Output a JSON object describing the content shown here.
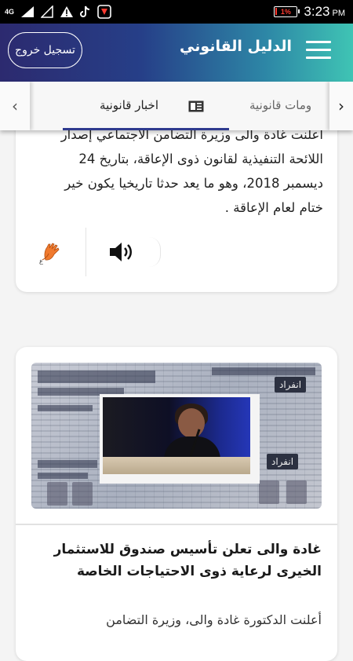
{
  "status_bar": {
    "network": "4G",
    "battery": "1%",
    "time": "3:23",
    "ampm": "PM"
  },
  "header": {
    "title": "الدليل القانوني",
    "logout_label": "تسجيل خروج"
  },
  "tabs": {
    "items": [
      {
        "label": "اخبار قانونية",
        "icon": "newspaper-icon",
        "active": true
      },
      {
        "label": "ومات قانونية",
        "active": false
      }
    ]
  },
  "card1": {
    "text_lines": [
      "أعلنت غادة والى وزيرة التضامن الاجتماعي إصدار",
      "اللائحة التنفيذية لقانون ذوى الإعاقة، بتاريخ 24",
      "ديسمبر 2018، وهو ما يعد حدثا تاريخيا يكون خير",
      "ختام لعام الإعاقة ."
    ],
    "actions": [
      "sign-language-icon",
      "speaker-icon"
    ]
  },
  "card2": {
    "image_tags": [
      "انفراد",
      "انفراد"
    ],
    "title": "غادة والى تعلن تأسيس صندوق للاستثمار الخيرى لرعاية ذوى الاحتياجات الخاصة",
    "excerpt": "أعلنت الدكتورة غادة والى، وزيرة التضامن"
  },
  "colors": {
    "header_gradient_start": "#2c2a6f",
    "header_gradient_end": "#3fc4b4",
    "tab_underline": "#2f3b8f"
  }
}
